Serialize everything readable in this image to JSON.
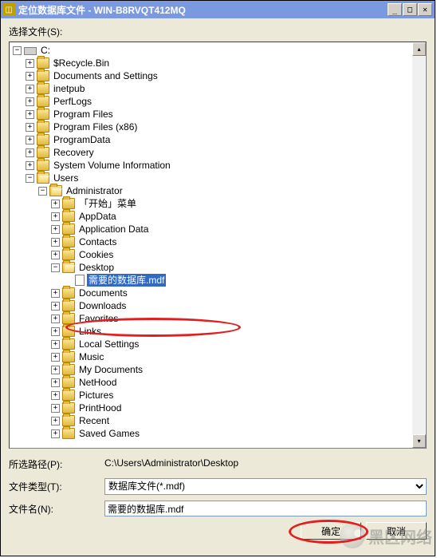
{
  "title": "定位数据库文件 - WIN-B8RVQT412MQ",
  "select_label": "选择文件(S):",
  "tree": {
    "root": "C:",
    "folders_c": [
      "$Recycle.Bin",
      "Documents and Settings",
      "inetpub",
      "PerfLogs",
      "Program Files",
      "Program Files (x86)",
      "ProgramData",
      "Recovery",
      "System Volume Information"
    ],
    "users": "Users",
    "administrator": "Administrator",
    "admin_top": [
      "「开始」菜单",
      "AppData",
      "Application Data",
      "Contacts",
      "Cookies"
    ],
    "desktop": "Desktop",
    "selected_file": "需要的数据库.mdf",
    "admin_bottom": [
      "Documents",
      "Downloads",
      "Favorites",
      "Links",
      "Local Settings",
      "Music",
      "My Documents",
      "NetHood",
      "Pictures",
      "PrintHood",
      "Recent",
      "Saved Games"
    ]
  },
  "path_label": "所选路径(P):",
  "path_value": "C:\\Users\\Administrator\\Desktop",
  "type_label": "文件类型(T):",
  "type_value": "数据库文件(*.mdf)",
  "name_label": "文件名(N):",
  "name_value": "需要的数据库.mdf",
  "ok_label": "确定",
  "cancel_label": "取消",
  "watermark": "黑区网络"
}
